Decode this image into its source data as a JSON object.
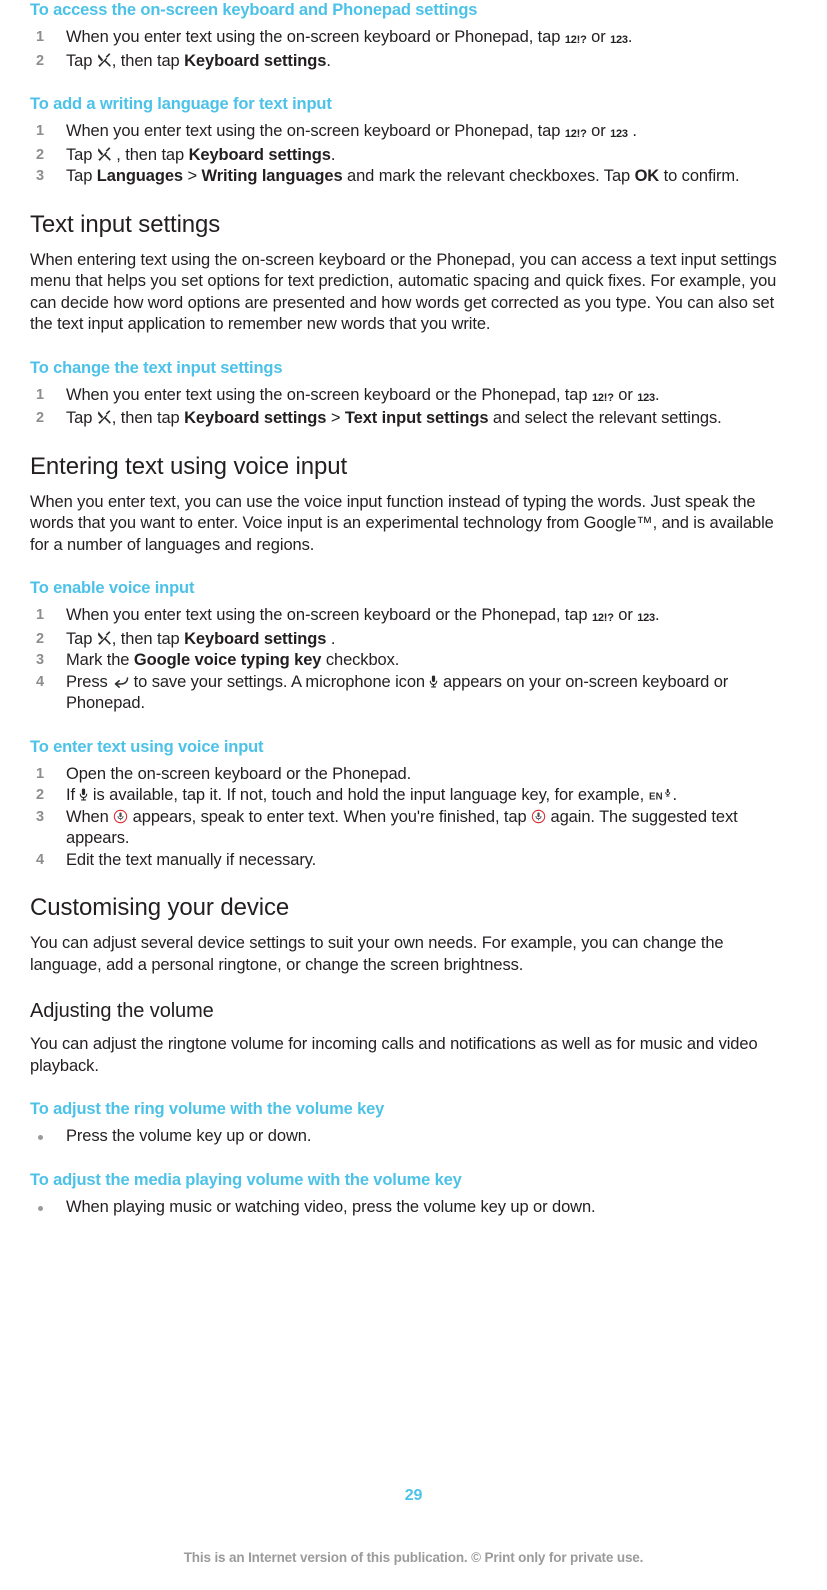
{
  "document": {
    "page_number": "29",
    "footnote": "This is an Internet version of this publication. © Print only for private use.",
    "accent_color": "#4cc2e8",
    "text_color": "#231f20",
    "marker_color": "#8d8d8d"
  },
  "blocks": [
    {
      "id": "task_access_keyboard_settings",
      "type": "task",
      "heading": "To access the on-screen keyboard and Phonepad settings",
      "list_type": "ordered",
      "steps": [
        {
          "id": "step_1",
          "parts": [
            {
              "t": "text",
              "v": "When you enter text using the on-screen keyboard or Phonepad, tap "
            },
            {
              "t": "key",
              "v": "12!?"
            },
            {
              "t": "text",
              "v": " or "
            },
            {
              "t": "key",
              "v": "123"
            },
            {
              "t": "text",
              "v": "."
            }
          ]
        },
        {
          "id": "step_2",
          "parts": [
            {
              "t": "text",
              "v": "Tap "
            },
            {
              "t": "icon",
              "v": "wrench-icon"
            },
            {
              "t": "text",
              "v": ", then tap "
            },
            {
              "t": "bold",
              "v": "Keyboard settings"
            },
            {
              "t": "text",
              "v": "."
            }
          ]
        }
      ]
    },
    {
      "id": "task_add_writing_language",
      "type": "task",
      "heading": "To add a writing language for text input",
      "list_type": "ordered",
      "steps": [
        {
          "id": "step_1",
          "parts": [
            {
              "t": "text",
              "v": "When you enter text using the on-screen keyboard or Phonepad, tap "
            },
            {
              "t": "key",
              "v": "12!?"
            },
            {
              "t": "text",
              "v": " or "
            },
            {
              "t": "key",
              "v": "123"
            },
            {
              "t": "text",
              "v": " ."
            }
          ]
        },
        {
          "id": "step_2",
          "parts": [
            {
              "t": "text",
              "v": "Tap "
            },
            {
              "t": "icon",
              "v": "wrench-icon"
            },
            {
              "t": "text",
              "v": " , then tap "
            },
            {
              "t": "bold",
              "v": "Keyboard settings"
            },
            {
              "t": "text",
              "v": "."
            }
          ]
        },
        {
          "id": "step_3",
          "parts": [
            {
              "t": "text",
              "v": "Tap "
            },
            {
              "t": "bold",
              "v": "Languages"
            },
            {
              "t": "text",
              "v": " > "
            },
            {
              "t": "bold",
              "v": "Writing languages"
            },
            {
              "t": "text",
              "v": " and mark the relevant checkboxes. Tap "
            },
            {
              "t": "bold",
              "v": "OK"
            },
            {
              "t": "text",
              "v": " to confirm."
            }
          ]
        }
      ]
    },
    {
      "id": "section_text_input_settings",
      "type": "section",
      "level": 1,
      "heading": "Text input settings",
      "paragraphs": [
        "When entering text using the on-screen keyboard or the Phonepad, you can access a text input settings menu that helps you set options for text prediction, automatic spacing and quick fixes. For example, you can decide how word options are presented and how words get corrected as you type. You can also set the text input application to remember new words that you write."
      ]
    },
    {
      "id": "task_change_text_input_settings",
      "type": "task",
      "heading": "To change the text input settings",
      "list_type": "ordered",
      "steps": [
        {
          "id": "step_1",
          "parts": [
            {
              "t": "text",
              "v": "When you enter text using the on-screen keyboard or the Phonepad, tap "
            },
            {
              "t": "key",
              "v": "12!?"
            },
            {
              "t": "text",
              "v": " or "
            },
            {
              "t": "key",
              "v": "123"
            },
            {
              "t": "text",
              "v": "."
            }
          ]
        },
        {
          "id": "step_2",
          "parts": [
            {
              "t": "text",
              "v": "Tap "
            },
            {
              "t": "icon",
              "v": "wrench-icon"
            },
            {
              "t": "text",
              "v": ", then tap "
            },
            {
              "t": "bold",
              "v": "Keyboard settings"
            },
            {
              "t": "text",
              "v": " > "
            },
            {
              "t": "bold",
              "v": "Text input settings"
            },
            {
              "t": "text",
              "v": " and select the relevant settings."
            }
          ]
        }
      ]
    },
    {
      "id": "section_entering_text_voice",
      "type": "section",
      "level": 1,
      "heading": "Entering text using voice input",
      "paragraphs": [
        "When you enter text, you can use the voice input function instead of typing the words. Just speak the words that you want to enter. Voice input is an experimental technology from Google™, and is available for a number of languages and regions."
      ]
    },
    {
      "id": "task_enable_voice_input",
      "type": "task",
      "heading": "To enable voice input",
      "list_type": "ordered",
      "steps": [
        {
          "id": "step_1",
          "parts": [
            {
              "t": "text",
              "v": "When you enter text using the on-screen keyboard or the Phonepad, tap "
            },
            {
              "t": "key",
              "v": "12!?"
            },
            {
              "t": "text",
              "v": " or "
            },
            {
              "t": "key",
              "v": "123"
            },
            {
              "t": "text",
              "v": "."
            }
          ]
        },
        {
          "id": "step_2",
          "parts": [
            {
              "t": "text",
              "v": "Tap "
            },
            {
              "t": "icon",
              "v": "wrench-icon"
            },
            {
              "t": "text",
              "v": ", then tap "
            },
            {
              "t": "bold",
              "v": "Keyboard settings"
            },
            {
              "t": "text",
              "v": " ."
            }
          ]
        },
        {
          "id": "step_3",
          "parts": [
            {
              "t": "text",
              "v": "Mark the "
            },
            {
              "t": "bold",
              "v": "Google voice typing key"
            },
            {
              "t": "text",
              "v": " checkbox."
            }
          ]
        },
        {
          "id": "step_4",
          "parts": [
            {
              "t": "text",
              "v": "Press "
            },
            {
              "t": "icon",
              "v": "back-arrow-icon"
            },
            {
              "t": "text",
              "v": " to save your settings. A microphone icon "
            },
            {
              "t": "icon",
              "v": "microphone-icon"
            },
            {
              "t": "text",
              "v": " appears on your on-screen keyboard or Phonepad."
            }
          ]
        }
      ]
    },
    {
      "id": "task_enter_text_voice_input",
      "type": "task",
      "heading": "To enter text using voice input",
      "list_type": "ordered",
      "steps": [
        {
          "id": "step_1",
          "parts": [
            {
              "t": "text",
              "v": "Open the on-screen keyboard or the Phonepad."
            }
          ]
        },
        {
          "id": "step_2",
          "parts": [
            {
              "t": "text",
              "v": "If "
            },
            {
              "t": "icon",
              "v": "microphone-icon"
            },
            {
              "t": "text",
              "v": " is available, tap it. If not, touch and hold the input language key, for example, "
            },
            {
              "t": "icon",
              "v": "en-microphone-key-icon"
            },
            {
              "t": "text",
              "v": "."
            }
          ]
        },
        {
          "id": "step_3",
          "parts": [
            {
              "t": "text",
              "v": "When "
            },
            {
              "t": "icon",
              "v": "microphone-recording-icon"
            },
            {
              "t": "text",
              "v": " appears, speak to enter text. When you're finished, tap "
            },
            {
              "t": "icon",
              "v": "microphone-recording-icon"
            },
            {
              "t": "text",
              "v": " again. The suggested text appears."
            }
          ]
        },
        {
          "id": "step_4",
          "parts": [
            {
              "t": "text",
              "v": "Edit the text manually if necessary."
            }
          ]
        }
      ]
    },
    {
      "id": "section_customising_your_device",
      "type": "section",
      "level": 1,
      "heading": "Customising your device",
      "paragraphs": [
        "You can adjust several device settings to suit your own needs. For example, you can change the language, add a personal ringtone, or change the screen brightness."
      ]
    },
    {
      "id": "section_adjusting_the_volume",
      "type": "section",
      "level": 2,
      "heading": "Adjusting the volume",
      "paragraphs": [
        "You can adjust the ringtone volume for incoming calls and notifications as well as for music and video playback."
      ]
    },
    {
      "id": "task_adjust_ring_volume",
      "type": "task",
      "heading": "To adjust the ring volume with the volume key",
      "list_type": "bullet",
      "steps": [
        {
          "id": "step_1",
          "parts": [
            {
              "t": "text",
              "v": "Press the volume key up or down."
            }
          ]
        }
      ]
    },
    {
      "id": "task_adjust_media_volume",
      "type": "task",
      "heading": "To adjust the media playing volume with the volume key",
      "list_type": "bullet",
      "steps": [
        {
          "id": "step_1",
          "parts": [
            {
              "t": "text",
              "v": "When playing music or watching video, press the volume key up or down."
            }
          ]
        }
      ]
    }
  ]
}
